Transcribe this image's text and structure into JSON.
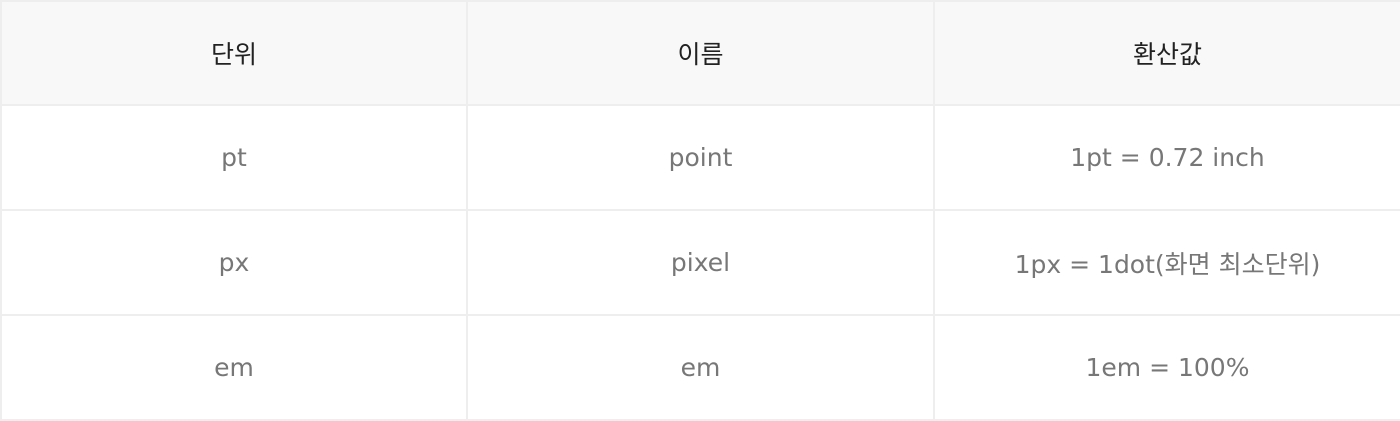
{
  "table": {
    "headers": [
      "단위",
      "이름",
      "환산값"
    ],
    "rows": [
      [
        "pt",
        "point",
        "1pt = 0.72 inch"
      ],
      [
        "px",
        "pixel",
        "1px = 1dot(화면 최소단위)"
      ],
      [
        "em",
        "em",
        "1em = 100%"
      ]
    ]
  },
  "colors": {
    "header_background": "#f8f8f8",
    "header_text": "#222222",
    "cell_text": "#777777",
    "border": "#eeeeee"
  }
}
